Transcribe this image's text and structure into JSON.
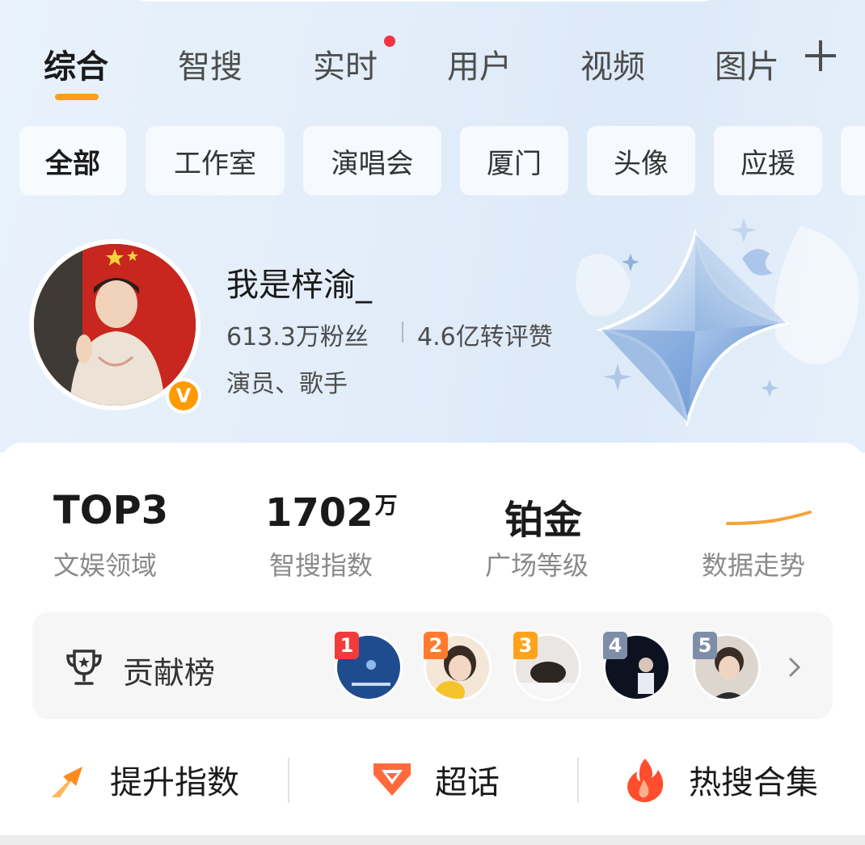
{
  "tabs": [
    {
      "label": "综合",
      "active": true
    },
    {
      "label": "智搜"
    },
    {
      "label": "实时",
      "has_badge_dot": true
    },
    {
      "label": "用户"
    },
    {
      "label": "视频"
    },
    {
      "label": "图片"
    }
  ],
  "filter_chips": [
    {
      "label": "全部",
      "active": true
    },
    {
      "label": "工作室"
    },
    {
      "label": "演唱会"
    },
    {
      "label": "厦门"
    },
    {
      "label": "头像"
    },
    {
      "label": "应援"
    }
  ],
  "profile": {
    "name": "我是梓渝_",
    "followers": "613.3万粉丝",
    "interactions": "4.6亿转评赞",
    "tags": "演员、歌手",
    "verified_badge": "V"
  },
  "metrics": [
    {
      "value": "TOP3",
      "unit": "",
      "label": "文娱领域"
    },
    {
      "value": "1702",
      "unit": "万",
      "label": "智搜指数"
    },
    {
      "value": "铂金",
      "unit": "",
      "label": "广场等级"
    },
    {
      "value": "",
      "unit": "",
      "label": "数据走势"
    }
  ],
  "contribution": {
    "label": "贡献榜",
    "ranks": [
      "1",
      "2",
      "3",
      "4",
      "5"
    ],
    "rank_colors": [
      "#f23b3b",
      "#ff7a2e",
      "#ffa31a",
      "#7e8da8",
      "#7e8da8"
    ]
  },
  "actions": [
    {
      "label": "提升指数",
      "icon": "arrow-up-icon"
    },
    {
      "label": "超话",
      "icon": "super-topic-icon"
    },
    {
      "label": "热搜合集",
      "icon": "flame-icon"
    }
  ],
  "colors": {
    "accent": "#ff9f1a",
    "badge_red": "#f5333f",
    "verified": "#ff9a00"
  }
}
